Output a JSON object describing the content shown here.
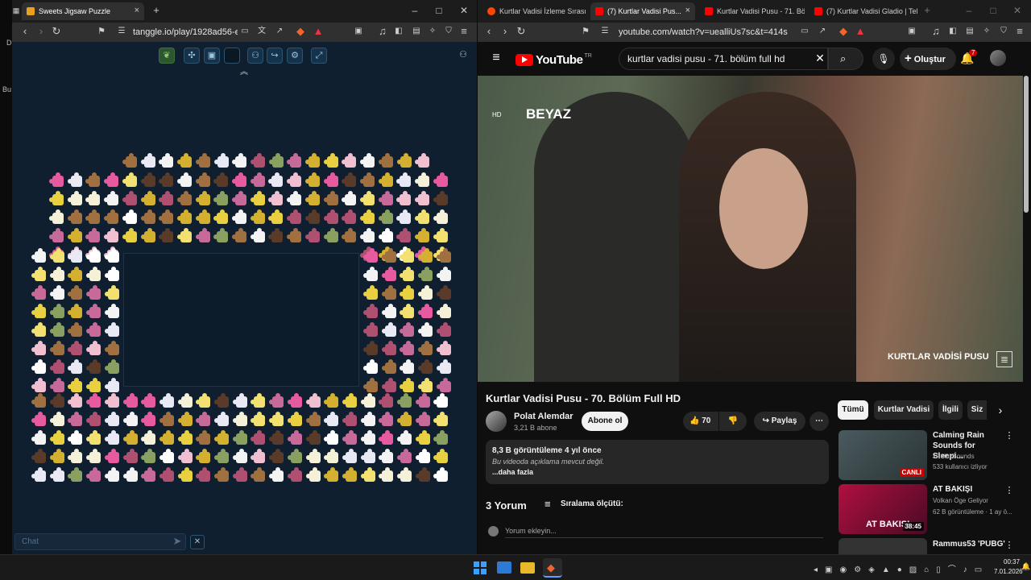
{
  "left_browser": {
    "tab_title": "Sweets Jigsaw Puzzle",
    "url": "tanggle.io/play/1928ad56-e...",
    "chat_placeholder": "Chat"
  },
  "right_browser": {
    "tabs": [
      {
        "label": "Kurtlar Vadisi İzleme Sırası : ..."
      },
      {
        "label": "(7) Kurtlar Vadisi Pus..."
      },
      {
        "label": "Kurtlar Vadisi Pusu - 71. Bölü..."
      },
      {
        "label": "(7) Kurtlar Vadisi Gladio | Tel..."
      }
    ],
    "url": "youtube.com/watch?v=uealliUs7sc&t=414s"
  },
  "youtube": {
    "logo": "YouTube",
    "logo_suffix": "TR",
    "search_query": "kurtlar vadisi pusu - 71. bölüm full hd",
    "create_label": "Oluştur",
    "notif_count": "7",
    "video_overlay_brand": "BEYAZ",
    "video_overlay_title": "KURTLAR VADİSİ PUSU",
    "video_title": "Kurtlar Vadisi Pusu - 70. Bölüm Full HD",
    "channel_name": "Polat Alemdar",
    "subscribers": "3,21 B abone",
    "subscribe_label": "Abone ol",
    "likes": "70",
    "share_label": "Paylaş",
    "views_line": "8,3 B görüntüleme  4 yıl önce",
    "description": "Bu videoda açıklama mevcut değil.",
    "more_label": "...daha fazla",
    "comments_count": "3 Yorum",
    "sort_label": "Sıralama ölçütü:",
    "comment_placeholder": "Yorum ekleyin...",
    "chips": [
      "Tümü",
      "Kurtlar Vadisi",
      "İlgili",
      "Siz"
    ],
    "recommendations": [
      {
        "title": "Calming Rain Sounds for Sleepi...",
        "channel": "xRelaxSounds",
        "meta": "533 kullanıcı izliyor",
        "badge": "CANLI"
      },
      {
        "title": "AT BAKIŞI",
        "channel": "Volkan Öge Geliyor",
        "meta": "62 B görüntüleme · 1 ay ö...",
        "badge": "38:45",
        "thumb_text": "AT BAKIŞI"
      },
      {
        "title": "Rammus53 'PUBG'",
        "channel": "",
        "meta": "",
        "badge": ""
      }
    ]
  },
  "taskbar": {
    "time": "00:37",
    "date": "7.01.2026"
  },
  "desktop_labels": [
    "D",
    "Bu"
  ]
}
